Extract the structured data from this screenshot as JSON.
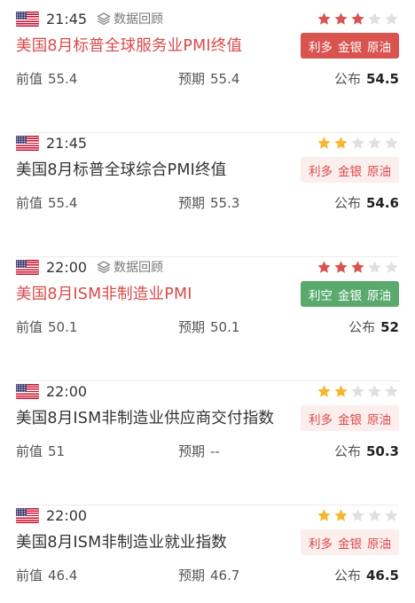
{
  "colors": {
    "red": "#d84a4a",
    "green": "#5aaa6e",
    "star_on_red": "#d9534f",
    "star_on_gold": "#f5b731",
    "star_off": "#e0e0e0"
  },
  "labels": {
    "prev": "前值",
    "expected": "预期",
    "published": "公布",
    "replay": "数据回顾"
  },
  "icons": {
    "flag": "us-flag-icon",
    "replay": "layers-icon",
    "star": "star-icon"
  },
  "events": [
    {
      "time": "21:45",
      "has_replay": true,
      "stars": 3,
      "star_color": "red",
      "title": "美国8月标普全球服务业PMI终值",
      "title_color": "red",
      "tag_style": "solid-red",
      "tag": [
        "利多",
        "金银",
        "原油"
      ],
      "prev": "55.4",
      "expected": "55.4",
      "published": "54.5"
    },
    {
      "time": "21:45",
      "has_replay": false,
      "stars": 2,
      "star_color": "gold",
      "title": "美国8月标普全球综合PMI终值",
      "title_color": "dark",
      "tag_style": "outline",
      "tag": [
        "利多",
        "金银",
        "原油"
      ],
      "prev": "55.4",
      "expected": "55.3",
      "published": "54.6"
    },
    {
      "time": "22:00",
      "has_replay": true,
      "stars": 3,
      "star_color": "red",
      "title": "美国8月ISM非制造业PMI",
      "title_color": "red",
      "tag_style": "solid-green",
      "tag": [
        "利空",
        "金银",
        "原油"
      ],
      "prev": "50.1",
      "expected": "50.1",
      "published": "52"
    },
    {
      "time": "22:00",
      "has_replay": false,
      "stars": 2,
      "star_color": "gold",
      "title": "美国8月ISM非制造业供应商交付指数",
      "title_color": "dark",
      "tag_style": "outline",
      "tag": [
        "利多",
        "金银",
        "原油"
      ],
      "prev": "51",
      "expected": "--",
      "published": "50.3"
    },
    {
      "time": "22:00",
      "has_replay": false,
      "stars": 2,
      "star_color": "gold",
      "title": "美国8月ISM非制造业就业指数",
      "title_color": "dark",
      "tag_style": "outline",
      "tag": [
        "利多",
        "金银",
        "原油"
      ],
      "prev": "46.4",
      "expected": "46.7",
      "published": "46.5"
    }
  ]
}
